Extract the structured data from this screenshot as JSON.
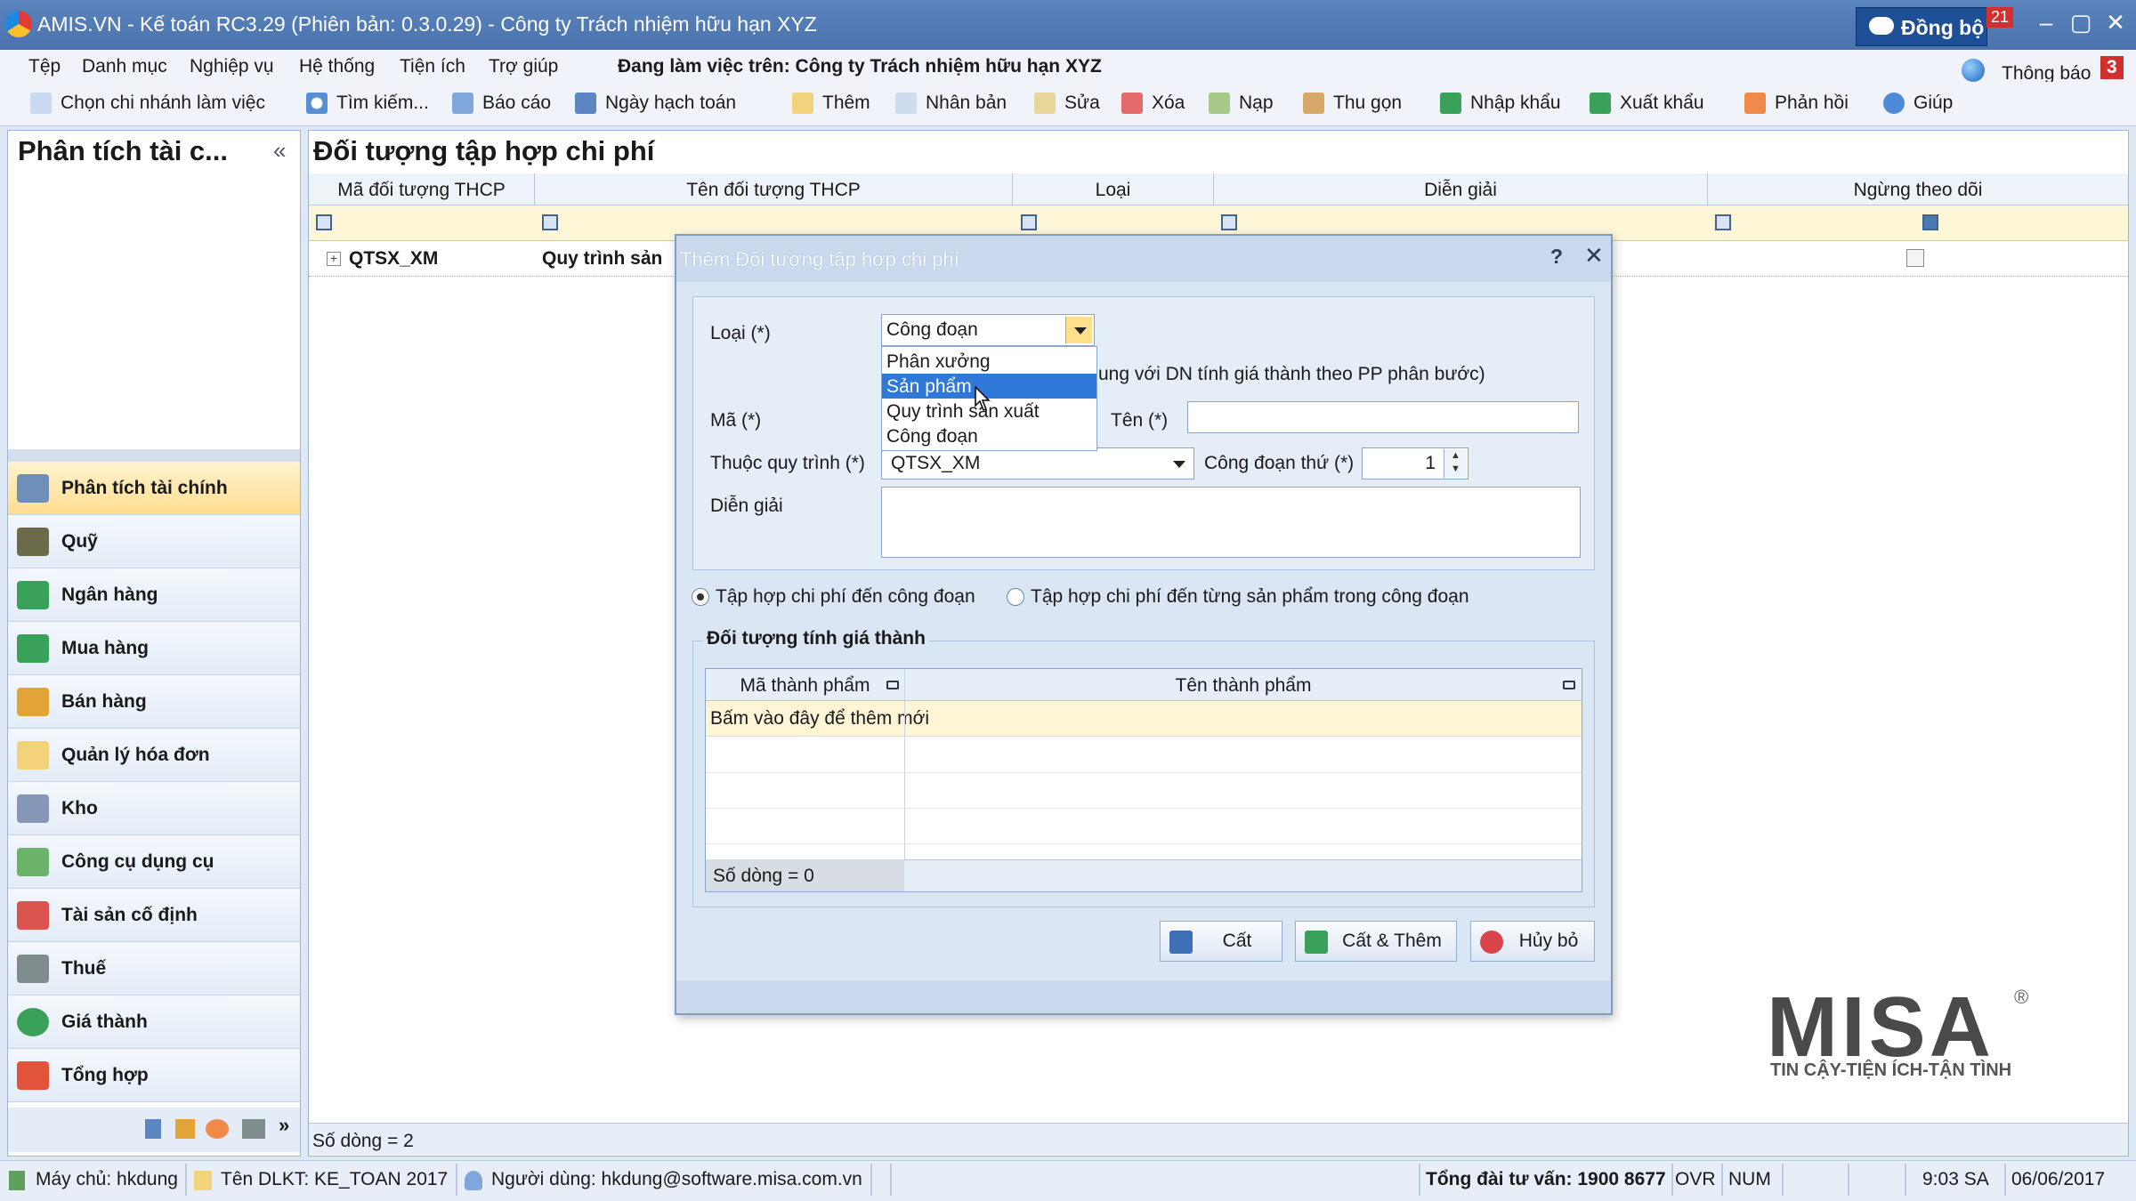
{
  "window": {
    "title": "AMIS.VN - Kế toán RC3.29 (Phiên bản: 0.3.0.29) - Công ty Trách nhiệm hữu hạn XYZ",
    "sync_label": "Đồng bộ",
    "sync_count": "21"
  },
  "menu": {
    "items": [
      "Tệp",
      "Danh mục",
      "Nghiệp vụ",
      "Hệ thống",
      "Tiện ích",
      "Trợ giúp"
    ],
    "working_on": "Đang làm việc trên: Công ty Trách nhiệm hữu hạn XYZ",
    "notification_label": "Thông báo",
    "notification_count": "3"
  },
  "toolbar": {
    "items": [
      "Chọn chi nhánh làm việc",
      "Tìm kiếm...",
      "Báo cáo",
      "Ngày hạch toán",
      "Thêm",
      "Nhân bản",
      "Sửa",
      "Xóa",
      "Nạp",
      "Thu gọn",
      "Nhập khẩu",
      "Xuất khẩu",
      "Phản hồi",
      "Giúp"
    ]
  },
  "sidebar": {
    "title": "Phân tích tài c...",
    "collapse": "«",
    "items": [
      "Phân tích tài chính",
      "Quỹ",
      "Ngân hàng",
      "Mua hàng",
      "Bán hàng",
      "Quản lý hóa đơn",
      "Kho",
      "Công cụ dụng cụ",
      "Tài sản cố định",
      "Thuế",
      "Giá thành",
      "Tổng hợp"
    ],
    "active": "Phân tích tài chính"
  },
  "main": {
    "title": "Đối tượng tập hợp chi phí",
    "columns": [
      "Mã đối tượng THCP",
      "Tên đối tượng THCP",
      "Loại",
      "Diễn giải",
      "Ngừng theo dõi"
    ],
    "row": {
      "code": "QTSX_XM",
      "name": "Quy trình sản"
    },
    "footer": "Số dòng = 2"
  },
  "dialog": {
    "title": "Thêm Đối tượng tập hợp chi phí",
    "help": "?",
    "close": "✕",
    "loai_label": "Loại (*)",
    "loai_value": "Công đoạn",
    "dropdown_options": [
      "Phân xưởng",
      "Sản phẩm",
      "Quy trình sản xuất",
      "Công đoạn"
    ],
    "dropdown_selected": "Sản phẩm",
    "hint": "ung với DN tính giá thành theo PP phân bước)",
    "ma_label": "Mã (*)",
    "ten_label": "Tên (*)",
    "quytrinh_label": "Thuộc quy trình (*)",
    "quytrinh_value": "QTSX_XM",
    "stage_label": "Công đoạn thứ (*)",
    "stage_value": "1",
    "diengiai_label": "Diễn giải",
    "radio1": "Tập hợp chi phí đến công đoạn",
    "radio2": "Tập hợp chi phí đến từng sản phẩm trong công đoạn",
    "group_title": "Đối tượng tính giá thành",
    "sub_columns": [
      "Mã thành phẩm",
      "Tên thành phẩm"
    ],
    "sub_new_row": "Bấm vào đây để thêm mới",
    "sub_footer": "Số dòng = 0",
    "btn_save": "Cất",
    "btn_save_add": "Cất & Thêm",
    "btn_cancel": "Hủy bỏ"
  },
  "logo": {
    "word": "MISA",
    "tagline": "TIN CẬY-TIỆN ÍCH-TẬN TÌNH",
    "reg": "®"
  },
  "status": {
    "server": "Máy chủ: hkdung",
    "dataset": "Tên DLKT: KE_TOAN 2017",
    "user": "Người dùng: hkdung@software.misa.com.vn",
    "hotline": "Tổng đài tư vấn: 1900 8677",
    "ovr": "OVR",
    "num": "NUM",
    "time": "9:03 SA",
    "date": "06/06/2017"
  }
}
